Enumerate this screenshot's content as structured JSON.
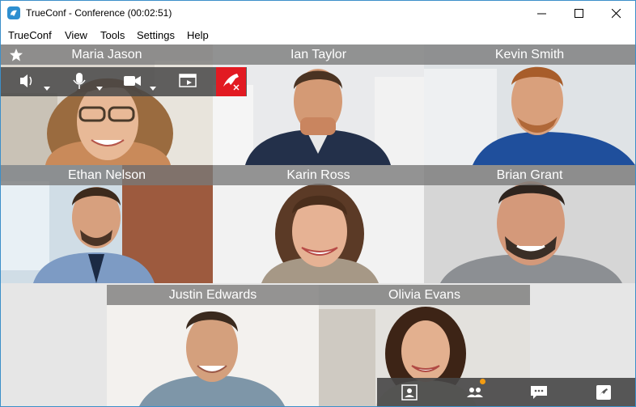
{
  "window": {
    "title": "TrueConf - Conference (00:02:51)"
  },
  "menu": {
    "items": [
      "TrueConf",
      "View",
      "Tools",
      "Settings",
      "Help"
    ]
  },
  "participants": [
    {
      "name": "Maria Jason"
    },
    {
      "name": "Ian Taylor"
    },
    {
      "name": "Kevin Smith"
    },
    {
      "name": "Ethan Nelson"
    },
    {
      "name": "Karin Ross"
    },
    {
      "name": "Brian Grant"
    },
    {
      "name": "Justin Edwards"
    },
    {
      "name": "Olivia Evans"
    }
  ],
  "colors": {
    "hangup": "#e21a22",
    "notification": "#f39c12",
    "accent": "#2e8fd0"
  }
}
